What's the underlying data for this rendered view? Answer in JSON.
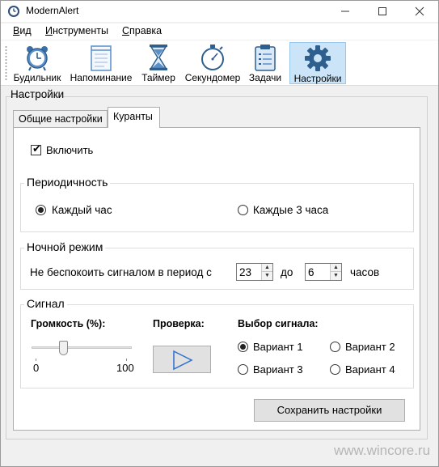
{
  "window": {
    "title": "ModernAlert",
    "controls": {
      "minimize_icon": "minimize-icon",
      "maximize_icon": "maximize-icon",
      "close_icon": "close-icon"
    }
  },
  "menu": {
    "items": [
      {
        "key": "В",
        "rest": "ид"
      },
      {
        "key": "И",
        "rest": "нструменты"
      },
      {
        "key": "С",
        "rest": "правка"
      }
    ]
  },
  "toolbar": {
    "buttons": [
      {
        "label": "Будильник",
        "icon": "alarm-clock-icon"
      },
      {
        "label": "Напоминание",
        "icon": "notepad-icon"
      },
      {
        "label": "Таймер",
        "icon": "hourglass-icon"
      },
      {
        "label": "Секундомер",
        "icon": "stopwatch-icon"
      },
      {
        "label": "Задачи",
        "icon": "clipboard-icon"
      },
      {
        "label": "Настройки",
        "icon": "gear-icon",
        "active": true
      }
    ]
  },
  "settings": {
    "title": "Настройки",
    "tabs": [
      {
        "label": "Общие настройки",
        "active": false
      },
      {
        "label": "Куранты",
        "active": true
      }
    ],
    "enable": {
      "label": "Включить",
      "checked": true
    },
    "periodicity": {
      "title": "Периодичность",
      "options": [
        {
          "label": "Каждый час",
          "selected": true
        },
        {
          "label": "Каждые 3 часа",
          "selected": false
        }
      ]
    },
    "night_mode": {
      "title": "Ночной режим",
      "prefix": "Не беспокоить сигналом в период с",
      "from_value": "23",
      "middle": "до",
      "to_value": "6",
      "suffix": "часов"
    },
    "signal": {
      "title": "Сигнал",
      "volume_label": "Громкость (%):",
      "volume_min": "0",
      "volume_max": "100",
      "volume_level_percent": 30,
      "check_label": "Проверка:",
      "choice_label": "Выбор сигнала:",
      "variants": [
        {
          "label": "Вариант 1",
          "selected": true
        },
        {
          "label": "Вариант 2",
          "selected": false
        },
        {
          "label": "Вариант 3",
          "selected": false
        },
        {
          "label": "Вариант 4",
          "selected": false
        }
      ]
    },
    "save_label": "Сохранить настройки"
  },
  "watermark": "www.wincore.ru",
  "colors": {
    "accent_active": "#cce4f7",
    "play_icon": "#2e6fd1",
    "gear": "#2f5f8f"
  }
}
